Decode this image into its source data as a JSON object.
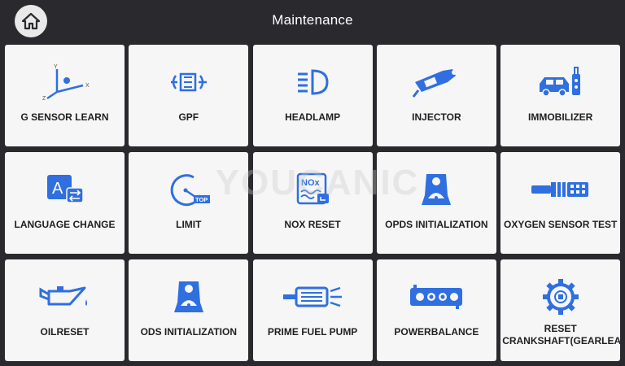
{
  "header": {
    "title": "Maintenance",
    "home_icon": "home-icon"
  },
  "accent_color": "#2f6fe0",
  "watermark": "YOUCANIC",
  "tiles": [
    {
      "label": "G SENSOR LEARN",
      "icon": "g-sensor-icon"
    },
    {
      "label": "GPF",
      "icon": "gpf-icon"
    },
    {
      "label": "HEADLAMP",
      "icon": "headlamp-icon"
    },
    {
      "label": "INJECTOR",
      "icon": "injector-icon"
    },
    {
      "label": "IMMOBILIZER",
      "icon": "immobilizer-icon"
    },
    {
      "label": "LANGUAGE CHANGE",
      "icon": "language-icon"
    },
    {
      "label": "LIMIT",
      "icon": "speed-limit-icon",
      "badge": "TOP"
    },
    {
      "label": "NOX RESET",
      "icon": "nox-icon",
      "badge": "NOx"
    },
    {
      "label": "OPDS INITIALIZATION",
      "icon": "occupant-seat-icon"
    },
    {
      "label": "OXYGEN SENSOR TEST",
      "icon": "oxygen-sensor-icon"
    },
    {
      "label": "OILRESET",
      "icon": "oil-can-icon"
    },
    {
      "label": "ODS INITIALIZATION",
      "icon": "occupant-seat-icon"
    },
    {
      "label": "PRIME FUEL PUMP",
      "icon": "fuel-pump-icon"
    },
    {
      "label": "POWERBALANCE",
      "icon": "engine-block-icon"
    },
    {
      "label": "RESET CRANKSHAFT(GEARLEARN)",
      "icon": "crankshaft-gear-icon"
    }
  ]
}
